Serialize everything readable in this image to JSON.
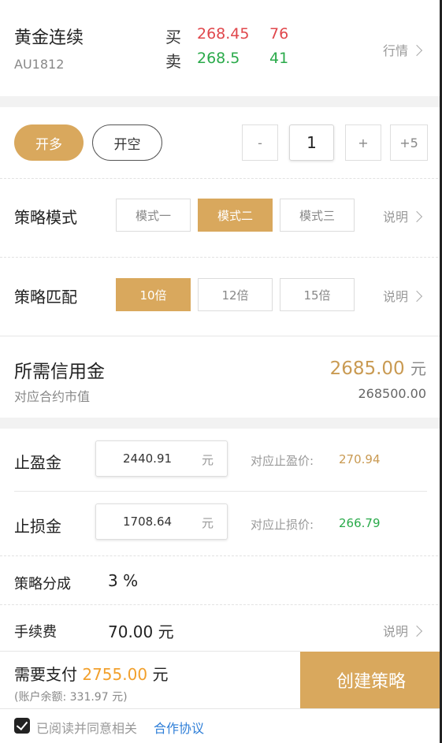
{
  "quote": {
    "name": "黄金连续",
    "code": "AU1812",
    "buy_label": "买",
    "buy_price": "268.45",
    "buy_volume": "76",
    "sell_label": "卖",
    "sell_price": "268.5",
    "sell_volume": "41",
    "market_link": "行情"
  },
  "direction": {
    "long_label": "开多",
    "short_label": "开空",
    "selected": "long"
  },
  "stepper": {
    "minus": "-",
    "value": "1",
    "plus": "+",
    "plus5": "+5"
  },
  "mode": {
    "label": "策略模式",
    "options": [
      "模式一",
      "模式二",
      "模式三"
    ],
    "selected_index": 1,
    "info": "说明"
  },
  "match": {
    "label": "策略匹配",
    "options": [
      "10倍",
      "12倍",
      "15倍"
    ],
    "selected_index": 0,
    "info": "说明"
  },
  "credit": {
    "label": "所需信用金",
    "amount": "2685.00",
    "unit": "元",
    "sub_label": "对应合约市值",
    "market_value": "268500.00"
  },
  "take_profit": {
    "label": "止盈金",
    "value": "2440.91",
    "unit": "元",
    "price_label": "对应止盈价:",
    "price": "270.94"
  },
  "stop_loss": {
    "label": "止损金",
    "value": "1708.64",
    "unit": "元",
    "price_label": "对应止损价:",
    "price": "266.79"
  },
  "share": {
    "label": "策略分成",
    "value": "3 %"
  },
  "fee": {
    "label": "手续费",
    "value": "70.00 元",
    "info": "说明"
  },
  "payment": {
    "label": "需要支付",
    "amount": "2755.00",
    "unit": "元",
    "balance": "(账户余额: 331.97 元)",
    "create_button": "创建策略"
  },
  "agreement": {
    "text": "已阅读并同意相关",
    "link": "合作协议",
    "checked": true
  },
  "colors": {
    "accent": "#d9a85d",
    "up_red": "#e0474c",
    "down_green": "#2aaa4a",
    "link_blue": "#2f7fd8",
    "gold_text": "#c99a52",
    "orange_amount": "#f2a02c"
  }
}
